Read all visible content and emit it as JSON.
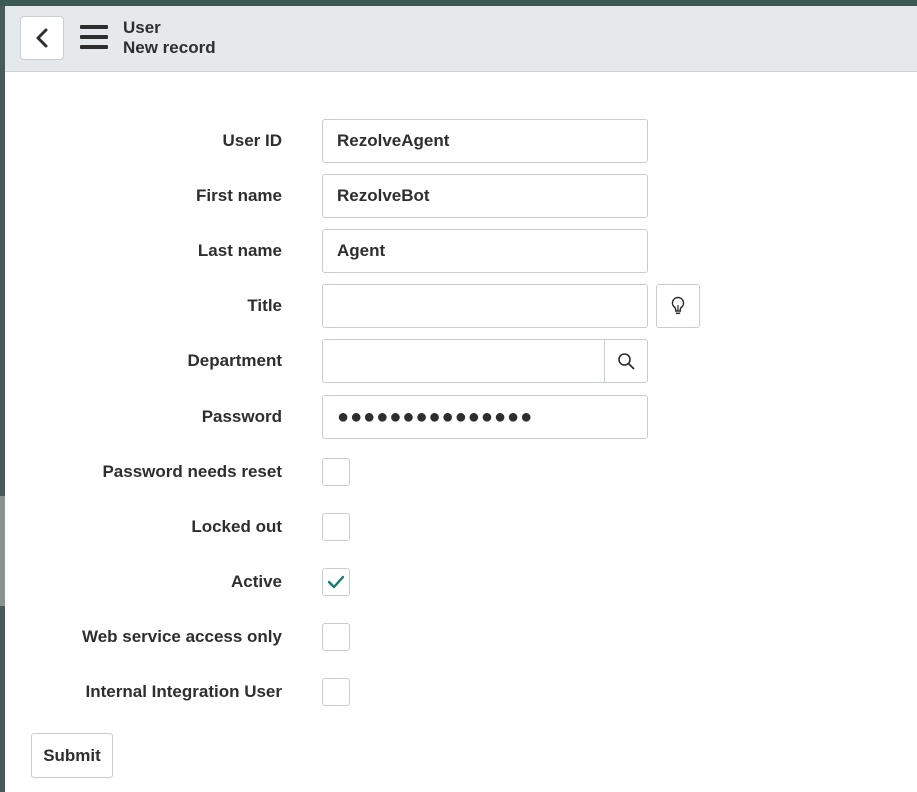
{
  "header": {
    "title": "User",
    "subtitle": "New record",
    "back_icon": "chevron-left-icon",
    "menu_icon": "hamburger-menu-icon"
  },
  "form": {
    "user_id": {
      "label": "User ID",
      "value": "RezolveAgent"
    },
    "first_name": {
      "label": "First name",
      "value": "RezolveBot"
    },
    "last_name": {
      "label": "Last name",
      "value": "Agent"
    },
    "title": {
      "label": "Title",
      "value": "",
      "suggest_icon": "lightbulb-icon"
    },
    "department": {
      "label": "Department",
      "value": "",
      "lookup_icon": "search-icon"
    },
    "password": {
      "label": "Password",
      "value": "●●●●●●●●●●●●●●●"
    },
    "password_needs_reset": {
      "label": "Password needs reset",
      "checked": false
    },
    "locked_out": {
      "label": "Locked out",
      "checked": false
    },
    "active": {
      "label": "Active",
      "checked": true
    },
    "web_service_access_only": {
      "label": "Web service access only",
      "checked": false
    },
    "internal_integration_user": {
      "label": "Internal Integration User",
      "checked": false
    }
  },
  "actions": {
    "submit_label": "Submit"
  },
  "colors": {
    "check": "#1f7a6e",
    "header_bg": "#e6e9eb",
    "top_strip": "#3d5a52"
  }
}
